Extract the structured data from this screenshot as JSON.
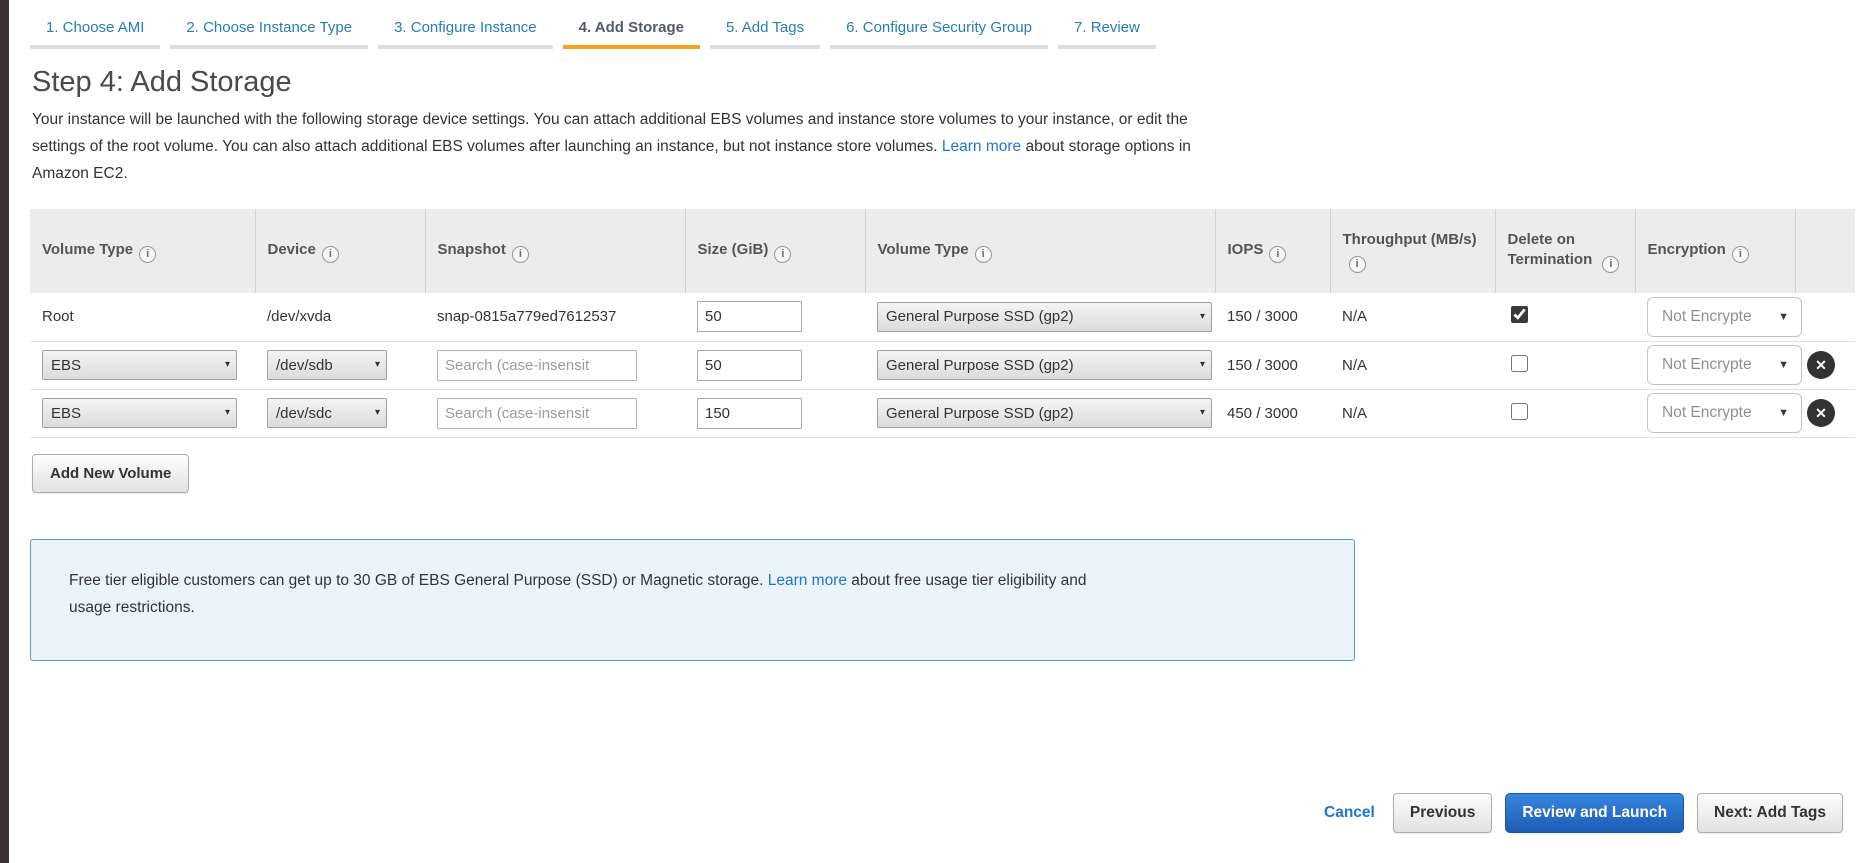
{
  "icons": {
    "info": "i",
    "select_caret": "▾",
    "dropdown_caret": "▼",
    "remove": "✕"
  },
  "colors": {
    "accent_orange": "#f5a31f",
    "link_blue": "#2673ce",
    "primary_button_blue": "#2a72cf",
    "free_tier_bg": "#e9f5fb",
    "free_tier_border": "#5e9cc8"
  },
  "wizard_tabs": [
    {
      "label": "1. Choose AMI",
      "active": false
    },
    {
      "label": "2. Choose Instance Type",
      "active": false
    },
    {
      "label": "3. Configure Instance",
      "active": false
    },
    {
      "label": "4. Add Storage",
      "active": true
    },
    {
      "label": "5. Add Tags",
      "active": false
    },
    {
      "label": "6. Configure Security Group",
      "active": false
    },
    {
      "label": "7. Review",
      "active": false
    }
  ],
  "header": {
    "title": "Step 4: Add Storage",
    "description_before": "Your instance will be launched with the following storage device settings. You can attach additional EBS volumes and instance store volumes to your instance, or edit the settings of the root volume. You can also attach additional EBS volumes after launching an instance, but not instance store volumes.",
    "description_link": "Learn more",
    "description_after": "about storage options in Amazon EC2."
  },
  "table": {
    "headers": [
      {
        "label": "Volume Type"
      },
      {
        "label": "Device"
      },
      {
        "label": "Snapshot"
      },
      {
        "label": "Size (GiB)"
      },
      {
        "label": "Volume Type"
      },
      {
        "label": "IOPS"
      },
      {
        "label": "Throughput (MB/s)"
      },
      {
        "label": "Delete on Termination"
      },
      {
        "label": "Encryption"
      }
    ],
    "rows": [
      {
        "volume_label": "Root",
        "device": "/dev/xvda",
        "snapshot": "snap-0815a779ed7612537",
        "size": "50",
        "volume_type": "General Purpose SSD (gp2)",
        "iops": "150 / 3000",
        "throughput": "N/A",
        "delete_on_termination": true,
        "encryption": "Not Encrypte"
      },
      {
        "volume_label": "EBS",
        "device": "/dev/sdb",
        "snapshot_placeholder": "Search (case-insensit",
        "size": "50",
        "volume_type": "General Purpose SSD (gp2)",
        "iops": "150 / 3000",
        "throughput": "N/A",
        "delete_on_termination": false,
        "encryption": "Not Encrypte"
      },
      {
        "volume_label": "EBS",
        "device": "/dev/sdc",
        "snapshot_placeholder": "Search (case-insensit",
        "size": "150",
        "volume_type": "General Purpose SSD (gp2)",
        "iops": "450 / 3000",
        "throughput": "N/A",
        "delete_on_termination": false,
        "encryption": "Not Encrypte"
      }
    ]
  },
  "add_new_volume_label": "Add New Volume",
  "free_tier": {
    "text_before": "Free tier eligible customers can get up to 30 GB of EBS General Purpose (SSD) or Magnetic storage.",
    "link": "Learn more",
    "text_after": "about free usage tier eligibility and usage restrictions."
  },
  "footer": {
    "cancel": "Cancel",
    "previous": "Previous",
    "review_and_launch": "Review and Launch",
    "next": "Next: Add Tags"
  }
}
